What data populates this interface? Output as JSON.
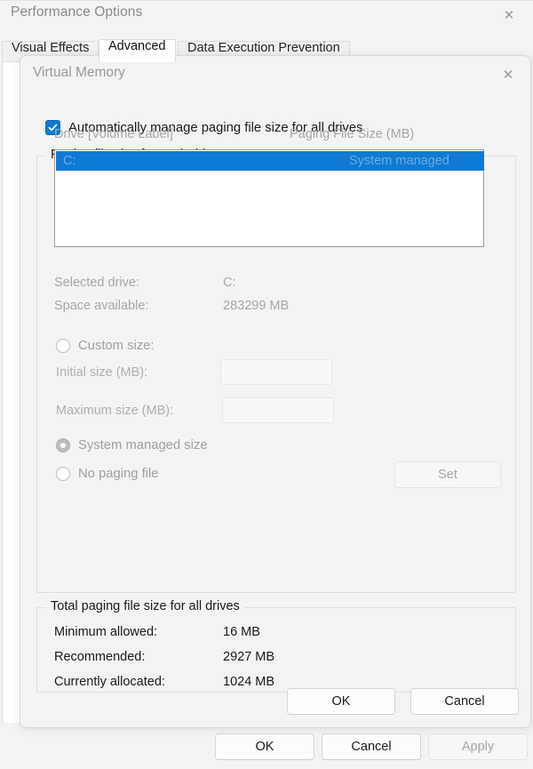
{
  "performance_options": {
    "title": "Performance Options",
    "close_icon": "close-icon",
    "tabs": [
      {
        "label": "Visual Effects",
        "active": false
      },
      {
        "label": "Advanced",
        "active": true
      },
      {
        "label": "Data Execution Prevention",
        "active": false
      }
    ],
    "footer": {
      "ok_label": "OK",
      "cancel_label": "Cancel",
      "apply_label": "Apply"
    }
  },
  "virtual_memory": {
    "title": "Virtual Memory",
    "close_icon": "close-icon",
    "auto_manage": {
      "label": "Automatically manage paging file size for all drives",
      "checked": true,
      "checkbox_color": "#0f7ad4"
    },
    "paging_group": {
      "title": "Paging file size for each drive",
      "columns": [
        "Drive  [Volume Label]",
        "Paging File Size (MB)"
      ],
      "rows": [
        {
          "drive": "C:",
          "size": "System managed",
          "selected": true
        }
      ],
      "selection_color": "#0f7ad4",
      "selected_drive_label": "Selected drive:",
      "selected_drive_value": "C:",
      "space_available_label": "Space available:",
      "space_available_value": "283299 MB",
      "custom_size_label": "Custom size:",
      "custom_size_selected": false,
      "initial_size_label": "Initial size (MB):",
      "initial_size_value": "",
      "maximum_size_label": "Maximum size (MB):",
      "maximum_size_value": "",
      "system_managed_label": "System managed size",
      "system_managed_selected": true,
      "no_paging_label": "No paging file",
      "no_paging_selected": false,
      "set_label": "Set"
    },
    "total_group": {
      "title": "Total paging file size for all drives",
      "minimum_label": "Minimum allowed:",
      "minimum_value": "16 MB",
      "recommended_label": "Recommended:",
      "recommended_value": "2927 MB",
      "allocated_label": "Currently allocated:",
      "allocated_value": "1024 MB"
    },
    "footer": {
      "ok_label": "OK",
      "cancel_label": "Cancel"
    }
  }
}
